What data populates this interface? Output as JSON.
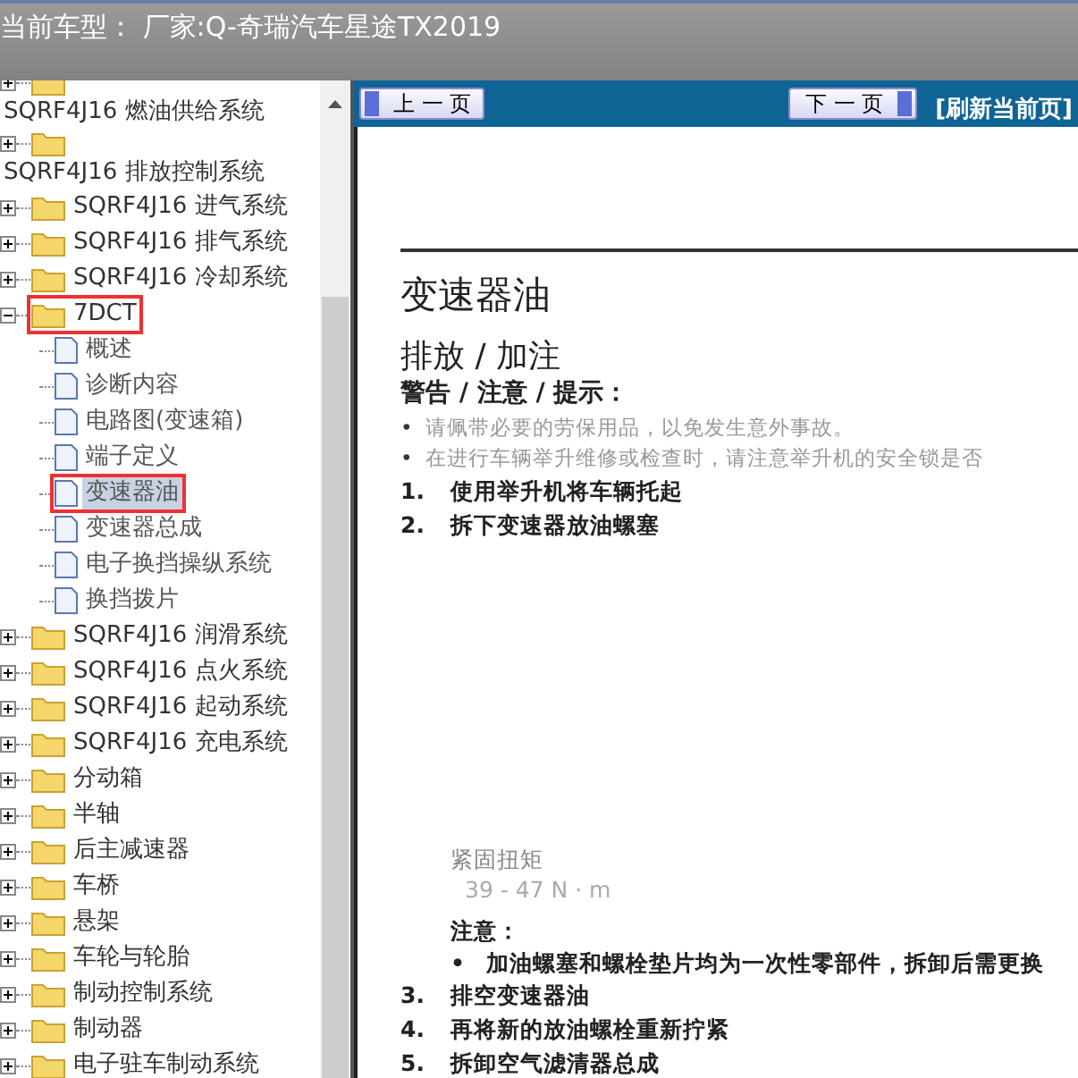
{
  "header": {
    "title": "当前车型： 厂家:Q-奇瑞汽车星途TX2019"
  },
  "tree": [
    {
      "label": "SQRF4J16 燃油供给系统",
      "kind": "folder",
      "expanded": false,
      "selected": false,
      "outlined": false
    },
    {
      "label": "SQRF4J16 排放控制系统",
      "kind": "folder",
      "expanded": false,
      "selected": false,
      "outlined": false
    },
    {
      "label": "SQRF4J16 进气系统",
      "kind": "folder",
      "expanded": false,
      "selected": false,
      "outlined": false
    },
    {
      "label": "SQRF4J16 排气系统",
      "kind": "folder",
      "expanded": false,
      "selected": false,
      "outlined": false
    },
    {
      "label": "SQRF4J16 冷却系统",
      "kind": "folder",
      "expanded": false,
      "selected": false,
      "outlined": false
    },
    {
      "label": "7DCT",
      "kind": "folder",
      "expanded": true,
      "selected": false,
      "outlined": true,
      "children": [
        {
          "label": "概述",
          "kind": "page",
          "selected": false,
          "outlined": false
        },
        {
          "label": "诊断内容",
          "kind": "page",
          "selected": false,
          "outlined": false
        },
        {
          "label": "电路图(变速箱)",
          "kind": "page",
          "selected": false,
          "outlined": false
        },
        {
          "label": "端子定义",
          "kind": "page",
          "selected": false,
          "outlined": false
        },
        {
          "label": "变速器油",
          "kind": "page",
          "selected": true,
          "outlined": true
        },
        {
          "label": "变速器总成",
          "kind": "page",
          "selected": false,
          "outlined": false
        },
        {
          "label": "电子换挡操纵系统",
          "kind": "page",
          "selected": false,
          "outlined": false
        },
        {
          "label": "换挡拨片",
          "kind": "page",
          "selected": false,
          "outlined": false
        }
      ]
    },
    {
      "label": "SQRF4J16 润滑系统",
      "kind": "folder",
      "expanded": false,
      "selected": false,
      "outlined": false
    },
    {
      "label": "SQRF4J16 点火系统",
      "kind": "folder",
      "expanded": false,
      "selected": false,
      "outlined": false
    },
    {
      "label": "SQRF4J16 起动系统",
      "kind": "folder",
      "expanded": false,
      "selected": false,
      "outlined": false
    },
    {
      "label": "SQRF4J16 充电系统",
      "kind": "folder",
      "expanded": false,
      "selected": false,
      "outlined": false
    },
    {
      "label": "分动箱",
      "kind": "folder",
      "expanded": false,
      "selected": false,
      "outlined": false
    },
    {
      "label": "半轴",
      "kind": "folder",
      "expanded": false,
      "selected": false,
      "outlined": false
    },
    {
      "label": "后主减速器",
      "kind": "folder",
      "expanded": false,
      "selected": false,
      "outlined": false
    },
    {
      "label": "车桥",
      "kind": "folder",
      "expanded": false,
      "selected": false,
      "outlined": false
    },
    {
      "label": "悬架",
      "kind": "folder",
      "expanded": false,
      "selected": false,
      "outlined": false
    },
    {
      "label": "车轮与轮胎",
      "kind": "folder",
      "expanded": false,
      "selected": false,
      "outlined": false
    },
    {
      "label": "制动控制系统",
      "kind": "folder",
      "expanded": false,
      "selected": false,
      "outlined": false
    },
    {
      "label": "制动器",
      "kind": "folder",
      "expanded": false,
      "selected": false,
      "outlined": false
    },
    {
      "label": "电子驻车制动系统",
      "kind": "folder",
      "expanded": false,
      "selected": false,
      "outlined": false
    }
  ],
  "nav": {
    "prev": "上 一 页",
    "next": "下 一 页",
    "refresh": "[刷新当前页]"
  },
  "document": [
    {
      "kind": "title",
      "text": "变速器油"
    },
    {
      "kind": "subtitle",
      "text": "排放 / 加注"
    },
    {
      "kind": "heading",
      "text": "警告 / 注意 / 提示："
    },
    {
      "kind": "warning",
      "marker": "•",
      "text": "请佩带必要的劳保用品，以免发生意外事故。"
    },
    {
      "kind": "warning",
      "marker": "•",
      "text": "在进行车辆举升维修或检查时，请注意举升机的安全锁是否"
    },
    {
      "kind": "step",
      "marker": "1.",
      "text": "使用举升机将车辆托起"
    },
    {
      "kind": "step",
      "marker": "2.",
      "text": "拆下变速器放油螺塞"
    },
    {
      "kind": "spacer"
    },
    {
      "kind": "spec_label",
      "text": "紧固扭矩"
    },
    {
      "kind": "spec_value",
      "text": "39 - 47 N · m"
    },
    {
      "kind": "note_heading",
      "text": "注意："
    },
    {
      "kind": "note",
      "marker": "•",
      "text": "加油螺塞和螺栓垫片均为一次性零部件，拆卸后需更换"
    },
    {
      "kind": "step",
      "marker": "3.",
      "text": "排空变速器油"
    },
    {
      "kind": "step",
      "marker": "4.",
      "text": "再将新的放油螺栓重新拧紧"
    },
    {
      "kind": "step",
      "marker": "5.",
      "text": "拆卸空气滤清器总成"
    }
  ]
}
